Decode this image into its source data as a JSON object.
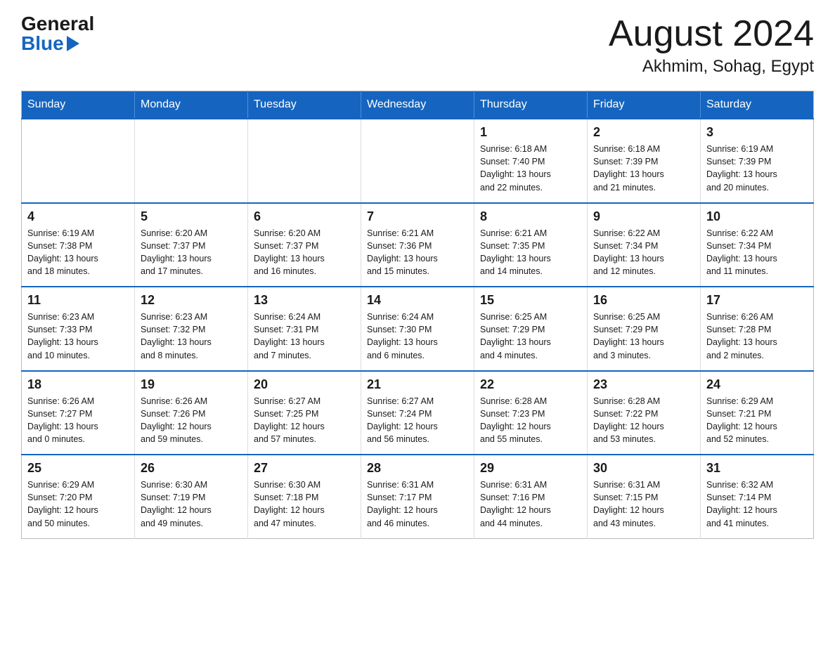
{
  "header": {
    "logo_general": "General",
    "logo_blue": "Blue",
    "month_year": "August 2024",
    "location": "Akhmim, Sohag, Egypt"
  },
  "weekdays": [
    "Sunday",
    "Monday",
    "Tuesday",
    "Wednesday",
    "Thursday",
    "Friday",
    "Saturday"
  ],
  "weeks": [
    [
      {
        "day": "",
        "info": ""
      },
      {
        "day": "",
        "info": ""
      },
      {
        "day": "",
        "info": ""
      },
      {
        "day": "",
        "info": ""
      },
      {
        "day": "1",
        "info": "Sunrise: 6:18 AM\nSunset: 7:40 PM\nDaylight: 13 hours\nand 22 minutes."
      },
      {
        "day": "2",
        "info": "Sunrise: 6:18 AM\nSunset: 7:39 PM\nDaylight: 13 hours\nand 21 minutes."
      },
      {
        "day": "3",
        "info": "Sunrise: 6:19 AM\nSunset: 7:39 PM\nDaylight: 13 hours\nand 20 minutes."
      }
    ],
    [
      {
        "day": "4",
        "info": "Sunrise: 6:19 AM\nSunset: 7:38 PM\nDaylight: 13 hours\nand 18 minutes."
      },
      {
        "day": "5",
        "info": "Sunrise: 6:20 AM\nSunset: 7:37 PM\nDaylight: 13 hours\nand 17 minutes."
      },
      {
        "day": "6",
        "info": "Sunrise: 6:20 AM\nSunset: 7:37 PM\nDaylight: 13 hours\nand 16 minutes."
      },
      {
        "day": "7",
        "info": "Sunrise: 6:21 AM\nSunset: 7:36 PM\nDaylight: 13 hours\nand 15 minutes."
      },
      {
        "day": "8",
        "info": "Sunrise: 6:21 AM\nSunset: 7:35 PM\nDaylight: 13 hours\nand 14 minutes."
      },
      {
        "day": "9",
        "info": "Sunrise: 6:22 AM\nSunset: 7:34 PM\nDaylight: 13 hours\nand 12 minutes."
      },
      {
        "day": "10",
        "info": "Sunrise: 6:22 AM\nSunset: 7:34 PM\nDaylight: 13 hours\nand 11 minutes."
      }
    ],
    [
      {
        "day": "11",
        "info": "Sunrise: 6:23 AM\nSunset: 7:33 PM\nDaylight: 13 hours\nand 10 minutes."
      },
      {
        "day": "12",
        "info": "Sunrise: 6:23 AM\nSunset: 7:32 PM\nDaylight: 13 hours\nand 8 minutes."
      },
      {
        "day": "13",
        "info": "Sunrise: 6:24 AM\nSunset: 7:31 PM\nDaylight: 13 hours\nand 7 minutes."
      },
      {
        "day": "14",
        "info": "Sunrise: 6:24 AM\nSunset: 7:30 PM\nDaylight: 13 hours\nand 6 minutes."
      },
      {
        "day": "15",
        "info": "Sunrise: 6:25 AM\nSunset: 7:29 PM\nDaylight: 13 hours\nand 4 minutes."
      },
      {
        "day": "16",
        "info": "Sunrise: 6:25 AM\nSunset: 7:29 PM\nDaylight: 13 hours\nand 3 minutes."
      },
      {
        "day": "17",
        "info": "Sunrise: 6:26 AM\nSunset: 7:28 PM\nDaylight: 13 hours\nand 2 minutes."
      }
    ],
    [
      {
        "day": "18",
        "info": "Sunrise: 6:26 AM\nSunset: 7:27 PM\nDaylight: 13 hours\nand 0 minutes."
      },
      {
        "day": "19",
        "info": "Sunrise: 6:26 AM\nSunset: 7:26 PM\nDaylight: 12 hours\nand 59 minutes."
      },
      {
        "day": "20",
        "info": "Sunrise: 6:27 AM\nSunset: 7:25 PM\nDaylight: 12 hours\nand 57 minutes."
      },
      {
        "day": "21",
        "info": "Sunrise: 6:27 AM\nSunset: 7:24 PM\nDaylight: 12 hours\nand 56 minutes."
      },
      {
        "day": "22",
        "info": "Sunrise: 6:28 AM\nSunset: 7:23 PM\nDaylight: 12 hours\nand 55 minutes."
      },
      {
        "day": "23",
        "info": "Sunrise: 6:28 AM\nSunset: 7:22 PM\nDaylight: 12 hours\nand 53 minutes."
      },
      {
        "day": "24",
        "info": "Sunrise: 6:29 AM\nSunset: 7:21 PM\nDaylight: 12 hours\nand 52 minutes."
      }
    ],
    [
      {
        "day": "25",
        "info": "Sunrise: 6:29 AM\nSunset: 7:20 PM\nDaylight: 12 hours\nand 50 minutes."
      },
      {
        "day": "26",
        "info": "Sunrise: 6:30 AM\nSunset: 7:19 PM\nDaylight: 12 hours\nand 49 minutes."
      },
      {
        "day": "27",
        "info": "Sunrise: 6:30 AM\nSunset: 7:18 PM\nDaylight: 12 hours\nand 47 minutes."
      },
      {
        "day": "28",
        "info": "Sunrise: 6:31 AM\nSunset: 7:17 PM\nDaylight: 12 hours\nand 46 minutes."
      },
      {
        "day": "29",
        "info": "Sunrise: 6:31 AM\nSunset: 7:16 PM\nDaylight: 12 hours\nand 44 minutes."
      },
      {
        "day": "30",
        "info": "Sunrise: 6:31 AM\nSunset: 7:15 PM\nDaylight: 12 hours\nand 43 minutes."
      },
      {
        "day": "31",
        "info": "Sunrise: 6:32 AM\nSunset: 7:14 PM\nDaylight: 12 hours\nand 41 minutes."
      }
    ]
  ]
}
